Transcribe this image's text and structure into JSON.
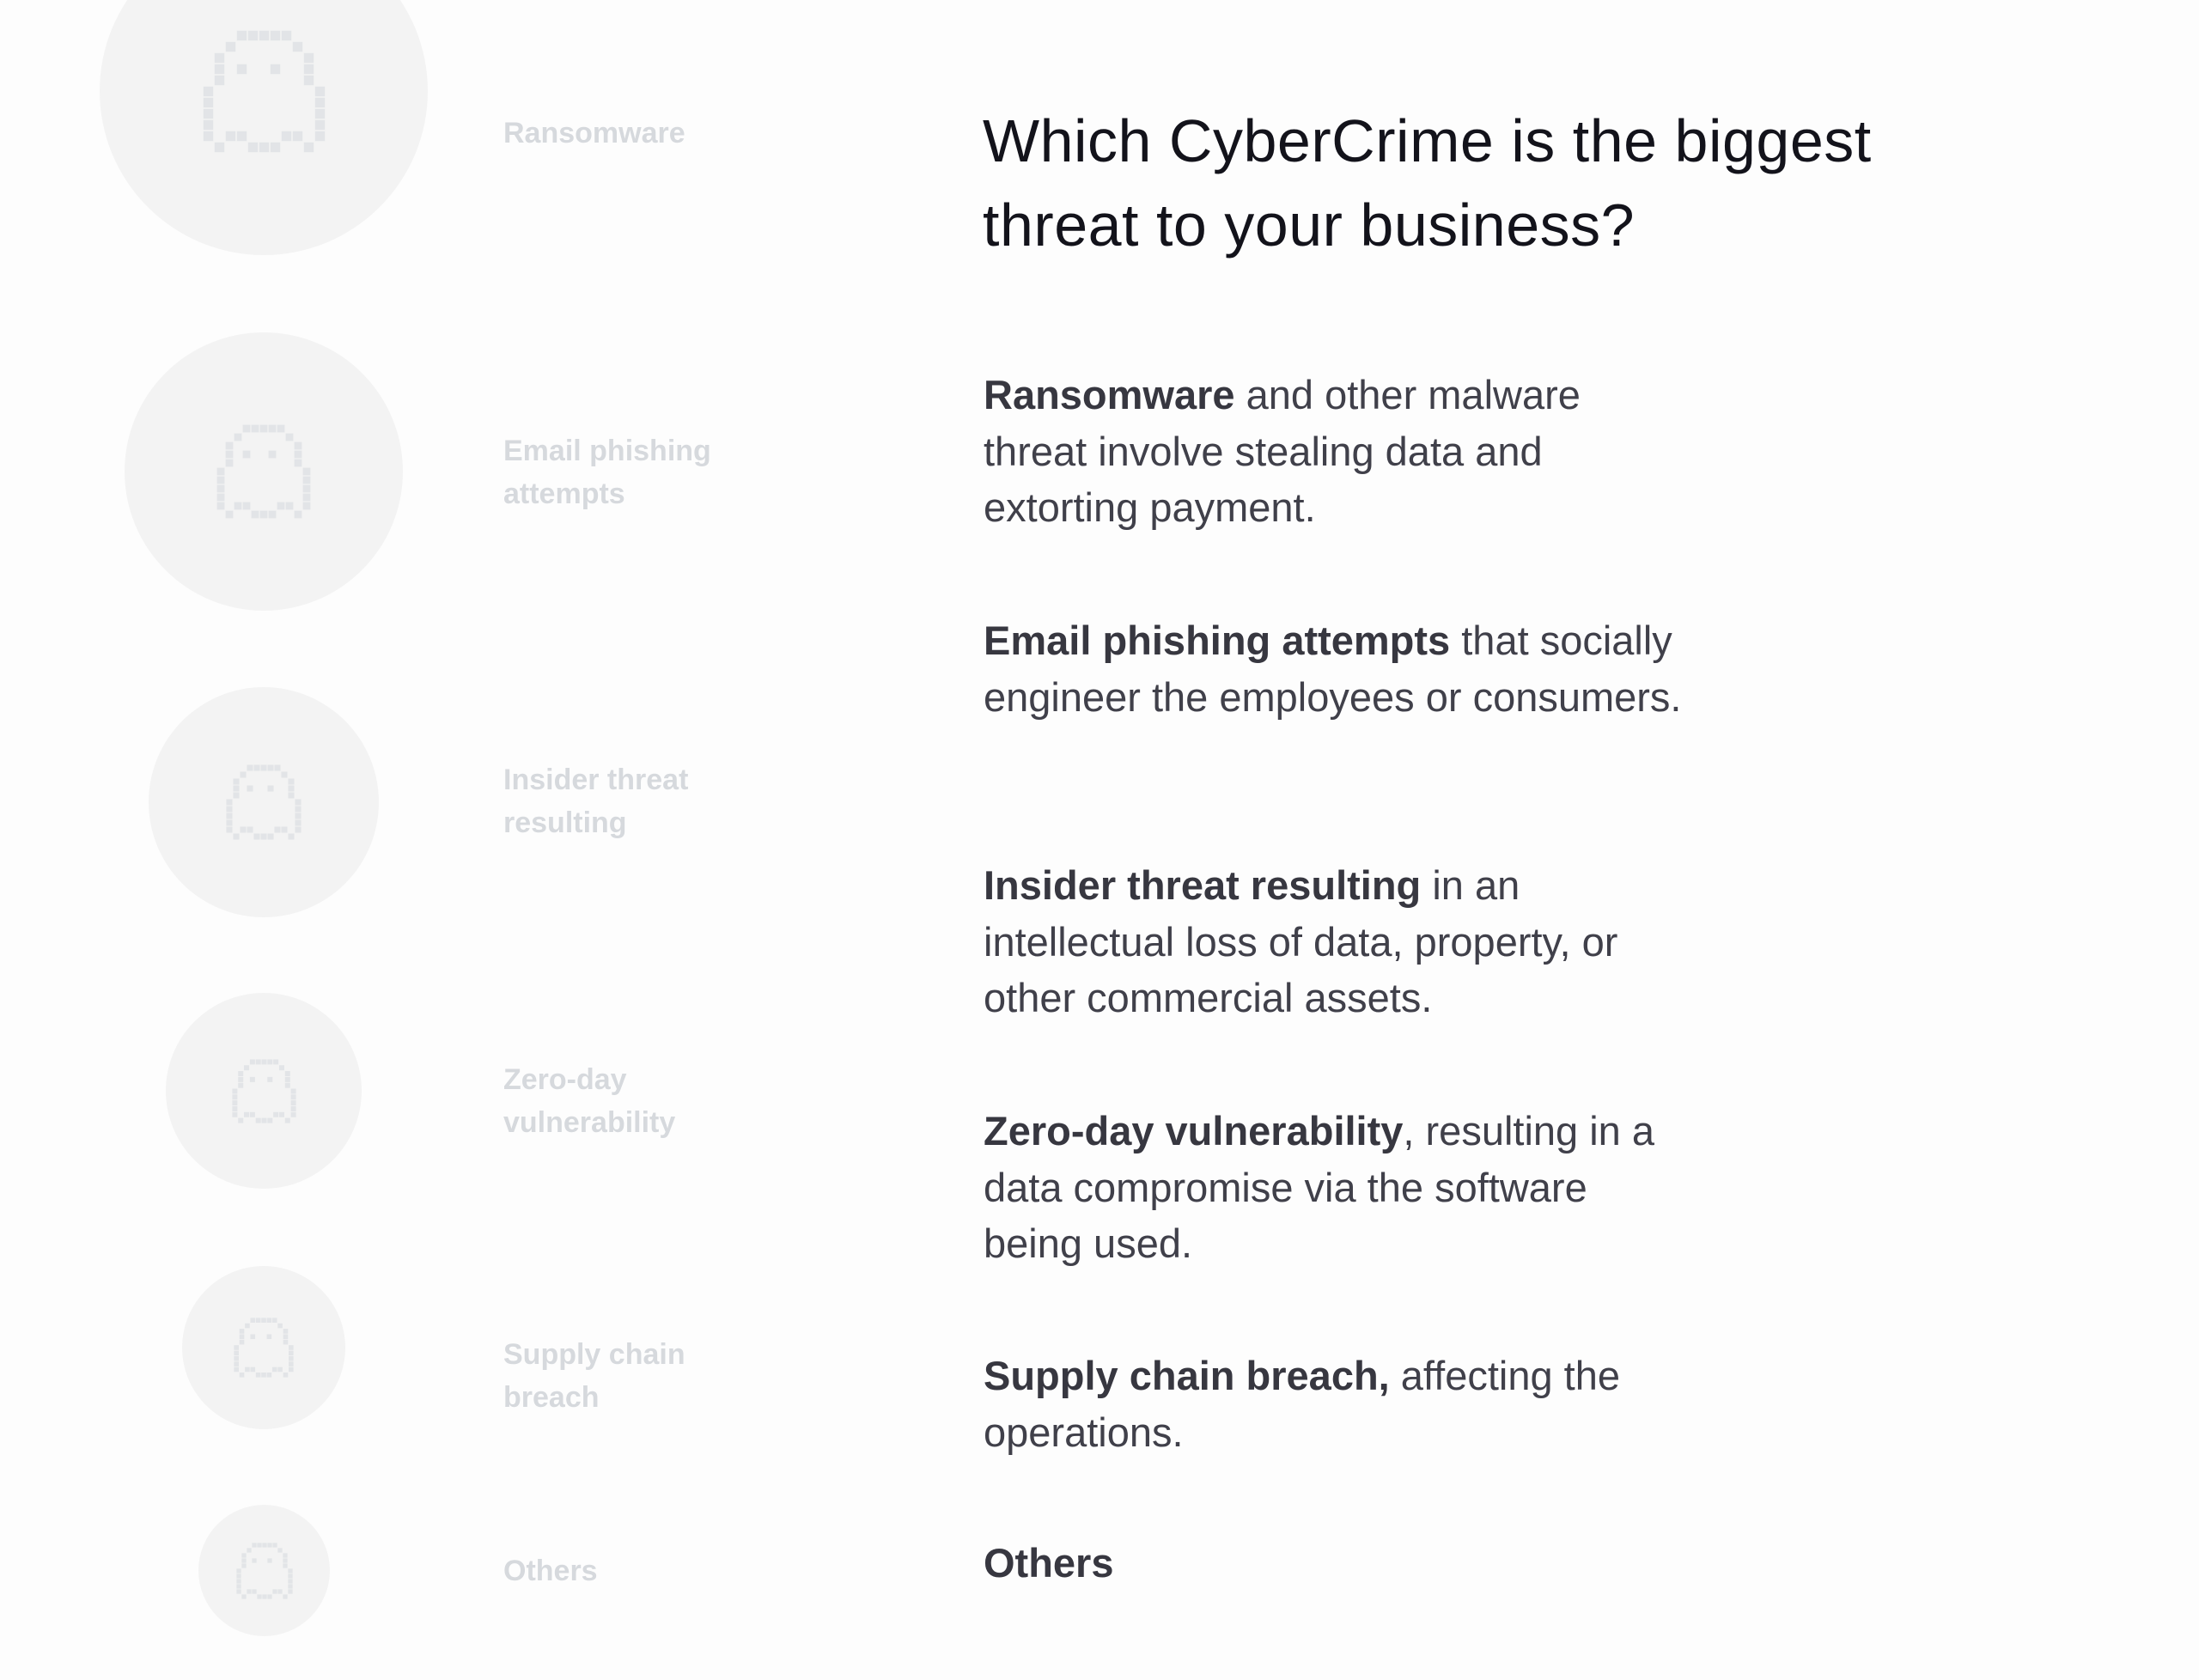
{
  "heading": {
    "line1": "Which CyberCrime is the biggest",
    "line2": "threat to your business?"
  },
  "options": [
    {
      "label_lines": [
        "Ransomware"
      ],
      "icon": "ghost-icon",
      "title": "Ransomware",
      "description": " and other malware threat involve stealing data and extorting payment."
    },
    {
      "label_lines": [
        "Email phishing",
        "attempts"
      ],
      "icon": "ghost-icon",
      "title": "Email phishing attempts",
      "description": " that socially engineer the employees or consumers."
    },
    {
      "label_lines": [
        "Insider threat",
        "resulting"
      ],
      "icon": "ghost-icon",
      "title": "Insider threat resulting",
      "description": " in an intellectual loss of data, property, or other commercial assets."
    },
    {
      "label_lines": [
        "Zero-day",
        "vulnerability"
      ],
      "icon": "ghost-icon",
      "title": "Zero-day vulnerability",
      "description": ", resulting in a data compromise via the software being used."
    },
    {
      "label_lines": [
        "Supply chain",
        "breach"
      ],
      "icon": "ghost-icon",
      "title": "Supply chain breach,",
      "description": " affecting the operations."
    },
    {
      "label_lines": [
        "Others"
      ],
      "icon": "ghost-icon",
      "title": "Others",
      "description": ""
    }
  ],
  "colors": {
    "background": "#fdfdfd",
    "circle": "#f3f3f3",
    "ghost": "#e2e4e7",
    "label": "#d6d9dd",
    "heading": "#13131b",
    "body": "#40404a"
  }
}
